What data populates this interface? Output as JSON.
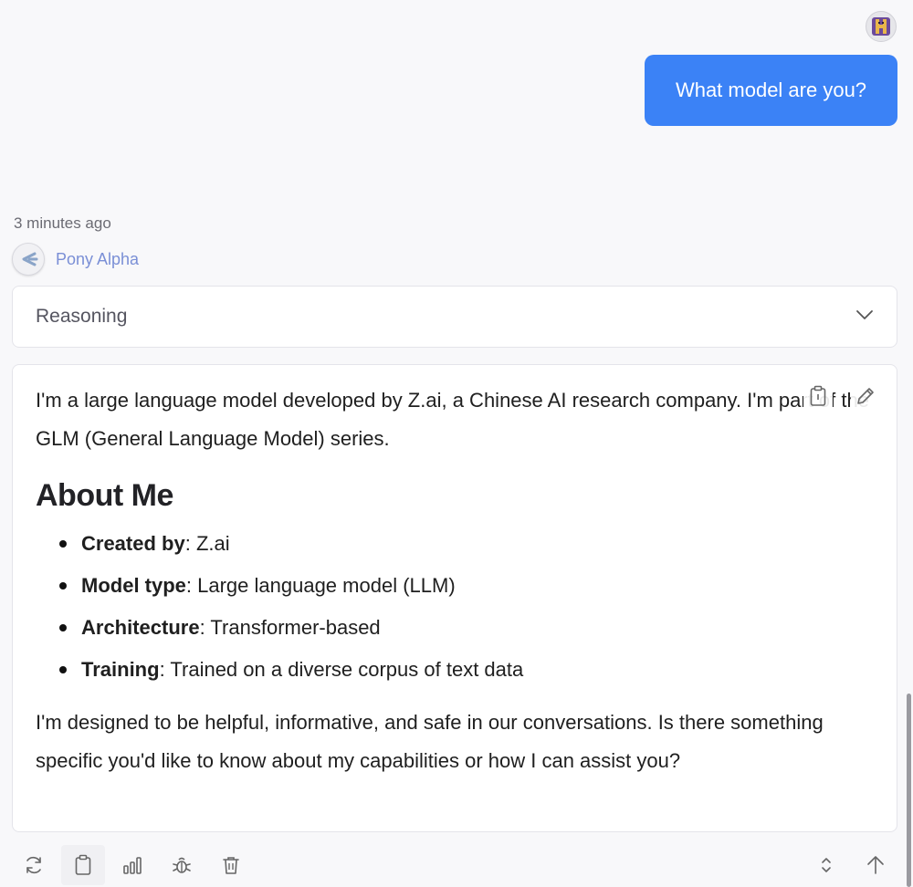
{
  "conversation": {
    "user_message": "What model are you?",
    "timestamp": "3 minutes ago",
    "model_name": "Pony Alpha",
    "reasoning_label": "Reasoning"
  },
  "response": {
    "intro": "I'm a large language model developed by Z.ai, a Chinese AI research company. I'm part of the GLM (General Language Model) series.",
    "heading": "About Me",
    "items": [
      {
        "label": "Created by",
        "value": ": Z.ai"
      },
      {
        "label": "Model type",
        "value": ": Large language model (LLM)"
      },
      {
        "label": "Architecture",
        "value": ": Transformer-based"
      },
      {
        "label": "Training",
        "value": ": Trained on a diverse corpus of text data"
      }
    ],
    "closing": "I'm designed to be helpful, informative, and safe in our conversations. Is there something specific you'd like to know about my capabilities or how I can assist you?"
  },
  "icons": {
    "user_avatar": "user-avatar",
    "model": "model-logo-icon",
    "reasoning_toggle": "chevron-down-icon",
    "copy": "clipboard-icon",
    "edit": "pencil-icon",
    "regenerate": "refresh-icon",
    "stats": "bar-chart-icon",
    "debug": "bug-icon",
    "delete": "trash-icon",
    "expand": "chevron-updown-icon",
    "scroll_top": "arrow-up-icon"
  },
  "colors": {
    "accent": "#3b82f6",
    "model_name": "#7a8fd6",
    "background": "#f8f8fa"
  }
}
